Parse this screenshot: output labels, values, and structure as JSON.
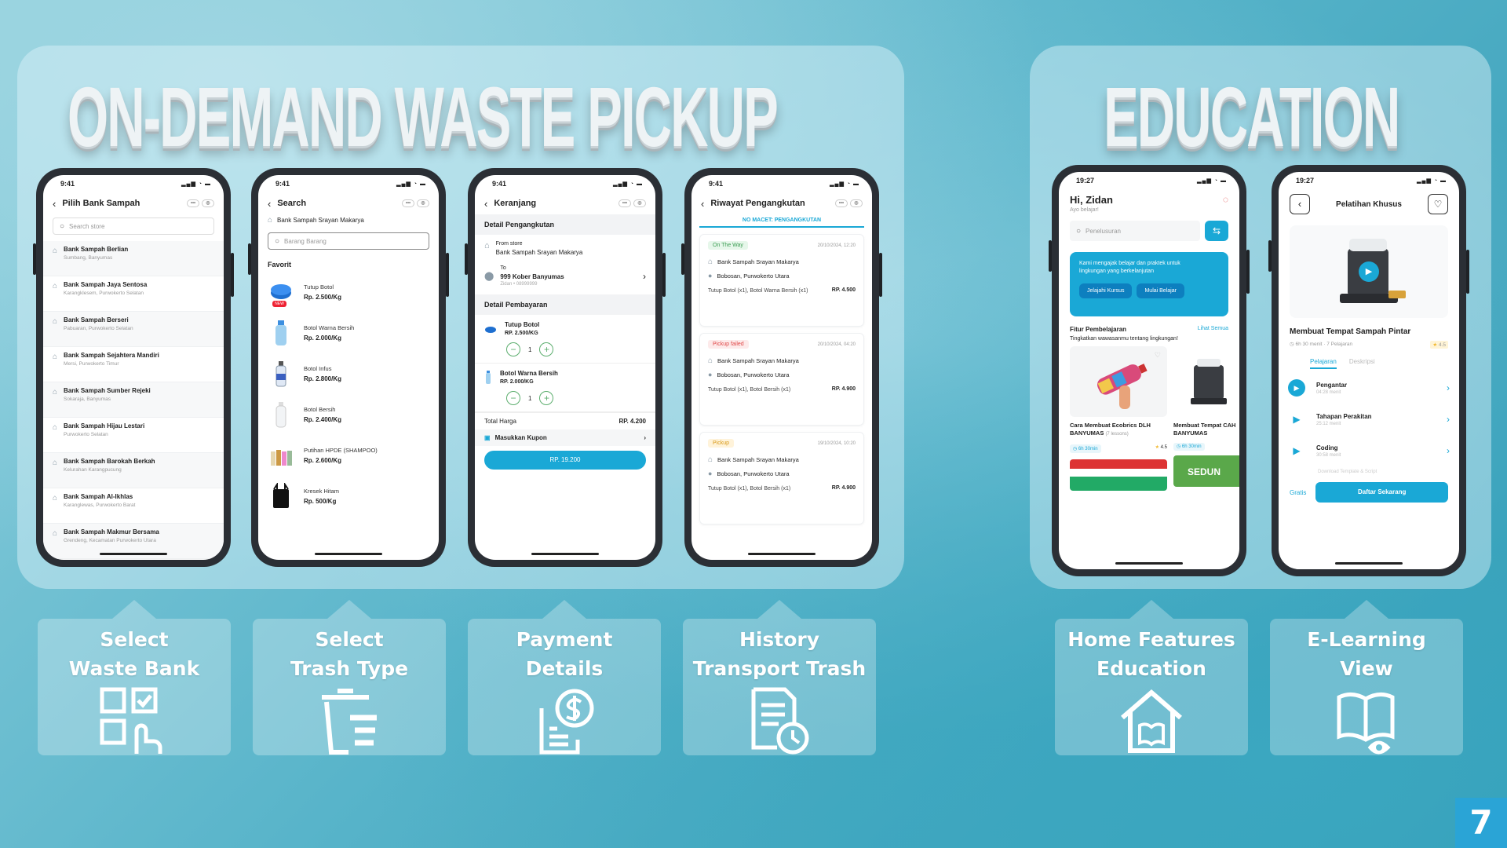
{
  "titles": {
    "left": "ON-DEMAND WASTE PICKUP",
    "right": "EDUCATION"
  },
  "page_number": "7",
  "phone1": {
    "time": "9:41",
    "title": "Pilih Bank Sampah",
    "search_placeholder": "Search store",
    "banks": [
      {
        "name": "Bank Sampah Berlian",
        "addr": "Sumbang, Banyumas"
      },
      {
        "name": "Bank Sampah Jaya Sentosa",
        "addr": "Karangklesem, Purwokerto Selatan"
      },
      {
        "name": "Bank Sampah Berseri",
        "addr": "Pabuaran, Purwokerto Selatan"
      },
      {
        "name": "Bank Sampah Sejahtera Mandiri",
        "addr": "Mersi, Purwokerto Timur"
      },
      {
        "name": "Bank Sampah Sumber Rejeki",
        "addr": "Sokaraja, Banyumas"
      },
      {
        "name": "Bank Sampah Hijau Lestari",
        "addr": "Purwokerto Selatan"
      },
      {
        "name": "Bank Sampah Barokah Berkah",
        "addr": "Kelurahan Karangpucung"
      },
      {
        "name": "Bank Sampah Al-Ikhlas",
        "addr": "Karanglewas, Purwokerto Barat"
      },
      {
        "name": "Bank Sampah Makmur Bersama",
        "addr": "Grendeng, Kecamatan Purwokerto Utara"
      }
    ]
  },
  "phone2": {
    "time": "9:41",
    "title": "Search",
    "store": "Bank Sampah Srayan Makarya",
    "search_placeholder": "Barang Barang",
    "section": "Favorit",
    "new_badge": "NEW",
    "items": [
      {
        "name": "Tutup Botol",
        "price": "Rp. 2.500/Kg"
      },
      {
        "name": "Botol Warna Bersih",
        "price": "Rp. 2.000/Kg"
      },
      {
        "name": "Botol Infus",
        "price": "Rp. 2.800/Kg"
      },
      {
        "name": "Botol Bersih",
        "price": "Rp. 2.400/Kg"
      },
      {
        "name": "Putihan HPDE (SHAMPOO)",
        "price": "Rp. 2.600/Kg"
      },
      {
        "name": "Kresek Hitam",
        "price": "Rp. 500/Kg"
      }
    ]
  },
  "phone3": {
    "time": "9:41",
    "title": "Keranjang",
    "sec_pickup": "Detail Pengangkutan",
    "from_label": "From store",
    "from_value": "Bank Sampah Srayan Makarya",
    "to_label": "To",
    "to_value": "999 Kober Banyumas",
    "to_sub": "Zidan • 08999999",
    "sec_payment": "Detail Pembayaran",
    "items": [
      {
        "name": "Tutup Botol",
        "price": "RP. 2.500/KG",
        "qty": "1"
      },
      {
        "name": "Botol Warna Bersih",
        "price": "RP. 2.000/KG",
        "qty": "1"
      }
    ],
    "total_label": "Total Harga",
    "total_value": "RP. 4.200",
    "coupon": "Masukkan Kupon",
    "pay_button": "RP. 19.200"
  },
  "phone4": {
    "time": "9:41",
    "title": "Riwayat Pengangkutan",
    "banner": "NO MACET: PENGANGKUTAN",
    "cards": [
      {
        "status": "On The Way",
        "date": "20/10/2024, 12:20",
        "store": "Bank Sampah Srayan Makarya",
        "addr": "Bobosan, Purwokerto Utara",
        "items": "Tutup Botol (x1), Botol Warna Bersih (x1)",
        "price": "RP. 4.500"
      },
      {
        "status": "Pickup failed",
        "date": "20/10/2024, 04:20",
        "store": "Bank Sampah Srayan Makarya",
        "addr": "Bobosan, Purwokerto Utara",
        "items": "Tutup Botol (x1), Botol Bersih (x1)",
        "price": "RP. 4.900"
      },
      {
        "status": "Pickup",
        "date": "19/10/2024, 10:20",
        "store": "Bank Sampah Srayan Makarya",
        "addr": "Bobosan, Purwokerto Utara",
        "items": "Tutup Botol (x1), Botol Bersih (x1)",
        "price": "RP. 4.900"
      }
    ]
  },
  "phone5": {
    "time": "19:27",
    "greeting": "Hi, Zidan",
    "sub": "Ayo belajar!",
    "search_placeholder": "Penelusuran",
    "banner_text": "Kami mengajak belajar dan praktek untuk lingkungan yang berkelanjutan",
    "btn1": "Jelajahi Kursus",
    "btn2": "Mulai Belajar",
    "feature_title": "Fitur Pembelajaran",
    "see_all": "Lihat Semua",
    "feature_sub": "Tingkatkan wawasanmu tentang lingkungan!",
    "course1_title": "Cara Membuat Ecobrics DLH BANYUMAS",
    "course1_lessons": "(7 lessons)",
    "course1_time": "6h 30min",
    "course1_rating": "4.5",
    "course2_title": "Membuat Tempat CAH BANYUMAS",
    "course2_time": "6h 30min",
    "promo_text": "SEDUN"
  },
  "phone6": {
    "time": "19:27",
    "title": "Pelatihan Khusus",
    "course_title": "Membuat Tempat Sampah Pintar",
    "meta": "6h 30 menit · 7 Pelajaran",
    "rating": "4.5",
    "tab1": "Pelajaran",
    "tab2": "Deskripsi",
    "lessons": [
      {
        "name": "Pengantar",
        "dur": "04:28 menit"
      },
      {
        "name": "Tahapan Perakitan",
        "dur": "25:12 menit"
      },
      {
        "name": "Coding",
        "dur": "30:58 menit"
      }
    ],
    "download": "Download Template & Script",
    "free": "Gratis",
    "cta": "Daftar Sekarang"
  },
  "captions": [
    {
      "line1": "Select",
      "line2": "Waste Bank",
      "icon": "grid-select-icon"
    },
    {
      "line1": "Select",
      "line2": "Trash Type",
      "icon": "trash-list-icon"
    },
    {
      "line1": "Payment",
      "line2": "Details",
      "icon": "invoice-dollar-icon"
    },
    {
      "line1": "History",
      "line2": "Transport Trash",
      "icon": "document-clock-icon"
    },
    {
      "line1": "Home Features",
      "line2": "Education",
      "icon": "house-book-icon"
    },
    {
      "line1": "E-Learning",
      "line2": "View",
      "icon": "book-eye-icon"
    }
  ],
  "colors": {
    "accent": "#1aa8d6",
    "green": "#5cae6e",
    "page_badge": "#2aa4d6"
  }
}
